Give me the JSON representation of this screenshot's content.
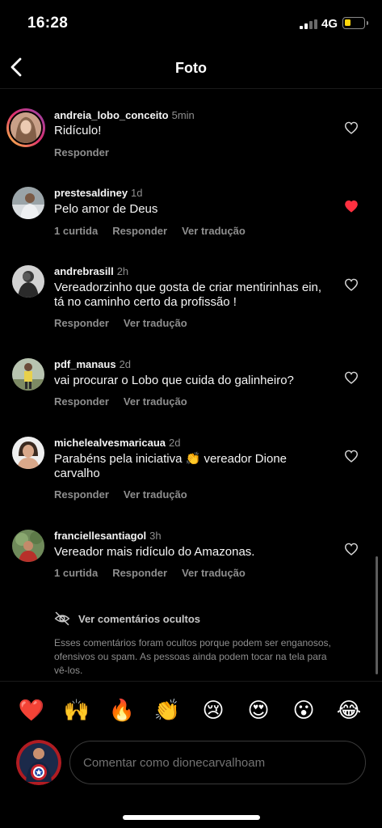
{
  "status": {
    "time": "16:28",
    "network": "4G"
  },
  "header": {
    "title": "Foto"
  },
  "comments": [
    {
      "username": "andreia_lobo_conceito",
      "time": "5min",
      "text": "Ridículo!",
      "likes": "",
      "reply": "Responder",
      "translate": "",
      "liked": false
    },
    {
      "username": "prestesaldiney",
      "time": "1d",
      "text": "Pelo amor de Deus",
      "likes": "1 curtida",
      "reply": "Responder",
      "translate": "Ver tradução",
      "liked": true
    },
    {
      "username": "andrebrasill",
      "time": "2h",
      "text": "Vereadorzinho que gosta de criar mentirinhas ein, tá no caminho certo da profissão !",
      "likes": "",
      "reply": "Responder",
      "translate": "Ver tradução",
      "liked": false
    },
    {
      "username": "pdf_manaus",
      "time": "2d",
      "text": "vai procurar o Lobo que cuida do galinheiro?",
      "likes": "",
      "reply": "Responder",
      "translate": "Ver tradução",
      "liked": false
    },
    {
      "username": "michelealvesmaricaua",
      "time": "2d",
      "text": "Parabéns pela iniciativa 👏 vereador Dione carvalho",
      "likes": "",
      "reply": "Responder",
      "translate": "Ver tradução",
      "liked": false
    },
    {
      "username": "franciellesantiagol",
      "time": "3h",
      "text": "Vereador mais ridículo do Amazonas.",
      "likes": "1 curtida",
      "reply": "Responder",
      "translate": "Ver tradução",
      "liked": false
    }
  ],
  "hidden": {
    "label": "Ver comentários ocultos",
    "description": "Esses comentários foram ocultos porque podem ser enganosos, ofensivos ou spam. As pessoas ainda podem tocar na tela para vê-los."
  },
  "emojis": [
    "❤️",
    "🙌",
    "🔥",
    "👏",
    "😢",
    "😍",
    "😮",
    "😂"
  ],
  "composer": {
    "placeholder": "Comentar como dionecarvalhoam"
  },
  "colors": {
    "like_active": "#ff3040",
    "secondary_text": "#8e8e8e",
    "background": "#000000"
  }
}
